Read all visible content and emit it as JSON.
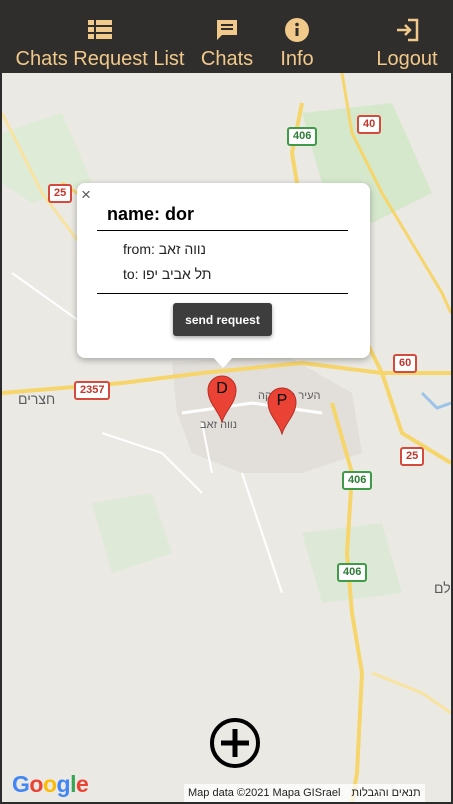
{
  "nav": {
    "items": [
      {
        "label": "Chats Request List",
        "icon": "list-icon"
      },
      {
        "label": "Chats",
        "icon": "chat-icon"
      },
      {
        "label": "Info",
        "icon": "info-icon"
      },
      {
        "label": "Logout",
        "icon": "logout-icon"
      }
    ],
    "accent": "#f1c98a",
    "background": "#2f2e2c"
  },
  "map": {
    "road_shields": [
      "406",
      "40",
      "25",
      "2357",
      "60",
      "25",
      "406",
      "406"
    ],
    "places": [
      "חצרים",
      "נווה זאב",
      "העיר העתיקה",
      "לם"
    ],
    "markers": [
      {
        "letter": "D",
        "color": "#ea4335"
      },
      {
        "letter": "P",
        "color": "#ea4335"
      }
    ],
    "logo": "Google",
    "attribution": "Map data ©2021 Mapa GISrael",
    "terms": "תנאים והגבלות"
  },
  "popup": {
    "close": "×",
    "name": "name: dor",
    "from_label": "from:",
    "from_value": "נווה זאב",
    "to_label": "to:",
    "to_value": "תל אביב יפו",
    "button": "send request"
  },
  "add_button": {
    "icon": "plus-circle-icon"
  }
}
